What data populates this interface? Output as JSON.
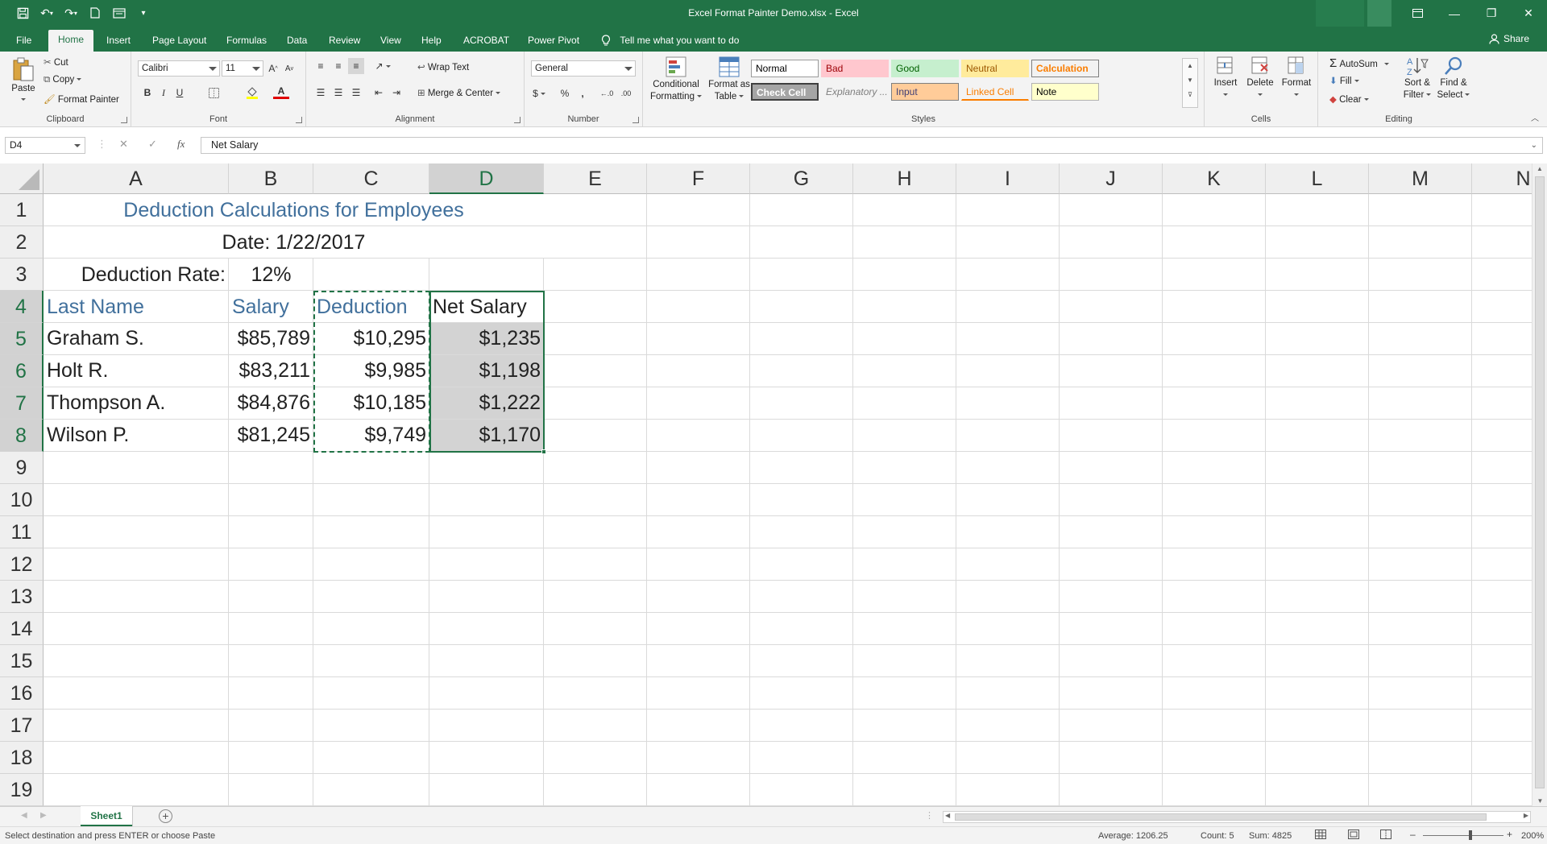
{
  "window": {
    "title": "Excel Format Painter Demo.xlsx  -  Excel"
  },
  "tabs": [
    "File",
    "Home",
    "Insert",
    "Page Layout",
    "Formulas",
    "Data",
    "Review",
    "View",
    "Help",
    "ACROBAT",
    "Power Pivot"
  ],
  "active_tab": "Home",
  "tell_me": "Tell me what you want to do",
  "share": "Share",
  "ribbon": {
    "clipboard": {
      "label": "Clipboard",
      "paste": "Paste",
      "cut": "Cut",
      "copy": "Copy",
      "format_painter": "Format Painter"
    },
    "font": {
      "label": "Font",
      "name": "Calibri",
      "size": "11"
    },
    "alignment": {
      "label": "Alignment",
      "wrap": "Wrap Text",
      "merge": "Merge & Center"
    },
    "number": {
      "label": "Number",
      "format": "General"
    },
    "styles": {
      "label": "Styles",
      "cond_fmt": [
        "Conditional",
        "Formatting"
      ],
      "fmt_table": [
        "Format as",
        "Table"
      ],
      "items": [
        {
          "label": "Normal",
          "bg": "#ffffff",
          "fg": "#000000",
          "border": "#9a9a9a"
        },
        {
          "label": "Bad",
          "bg": "#ffc7ce",
          "fg": "#9c0006"
        },
        {
          "label": "Good",
          "bg": "#c6efce",
          "fg": "#006100"
        },
        {
          "label": "Neutral",
          "bg": "#ffeb9c",
          "fg": "#9c5700"
        },
        {
          "label": "Calculation",
          "bg": "#f2f2f2",
          "fg": "#fa7d00",
          "border": "#7f7f7f"
        },
        {
          "label": "Check Cell",
          "bg": "#a5a5a5",
          "fg": "#ffffff",
          "border": "#3f3f3f"
        },
        {
          "label": "Explanatory ...",
          "bg": "#f3f3f3",
          "fg": "#7f7f7f"
        },
        {
          "label": "Input",
          "bg": "#ffcc99",
          "fg": "#3f3f76",
          "border": "#7f7f7f"
        },
        {
          "label": "Linked Cell",
          "bg": "#f3f3f3",
          "fg": "#fa7d00"
        },
        {
          "label": "Note",
          "bg": "#ffffcc",
          "fg": "#000000",
          "border": "#b2b2b2"
        }
      ]
    },
    "cells": {
      "label": "Cells",
      "insert": "Insert",
      "delete": "Delete",
      "format": "Format"
    },
    "editing": {
      "label": "Editing",
      "autosum": "AutoSum",
      "fill": "Fill",
      "clear": "Clear",
      "sort": [
        "Sort &",
        "Filter"
      ],
      "find": [
        "Find &",
        "Select"
      ]
    }
  },
  "namebox": "D4",
  "formula": "Net Salary",
  "columns": [
    "A",
    "B",
    "C",
    "D",
    "E",
    "F",
    "G",
    "H",
    "I",
    "J",
    "K",
    "L",
    "M",
    "N"
  ],
  "rows": [
    "1",
    "2",
    "3",
    "4",
    "5",
    "6",
    "7",
    "8",
    "9",
    "10",
    "11",
    "12",
    "13",
    "14",
    "15",
    "16",
    "17",
    "18",
    "19"
  ],
  "sheet": {
    "title": "Deduction Calculations for Employees",
    "date": "Date: 1/22/2017",
    "rate_label": "Deduction Rate:",
    "rate_value": "12%",
    "headers": [
      "Last Name",
      "Salary",
      "Deduction",
      "Net Salary"
    ],
    "data": [
      [
        "Graham S.",
        "$85,789",
        "$10,295",
        "$1,235"
      ],
      [
        "Holt R.",
        "$83,211",
        "$9,985",
        "$1,198"
      ],
      [
        "Thompson A.",
        "$84,876",
        "$10,185",
        "$1,222"
      ],
      [
        "Wilson P.",
        "$81,245",
        "$9,749",
        "$1,170"
      ]
    ]
  },
  "sheet_tabs": [
    "Sheet1"
  ],
  "status": {
    "message": "Select destination and press ENTER or choose Paste",
    "average": "Average: 1206.25",
    "count": "Count: 5",
    "sum": "Sum: 4825",
    "zoom": "200%"
  },
  "colors": {
    "excel_green": "#217346",
    "header_blue": "#41709c"
  }
}
